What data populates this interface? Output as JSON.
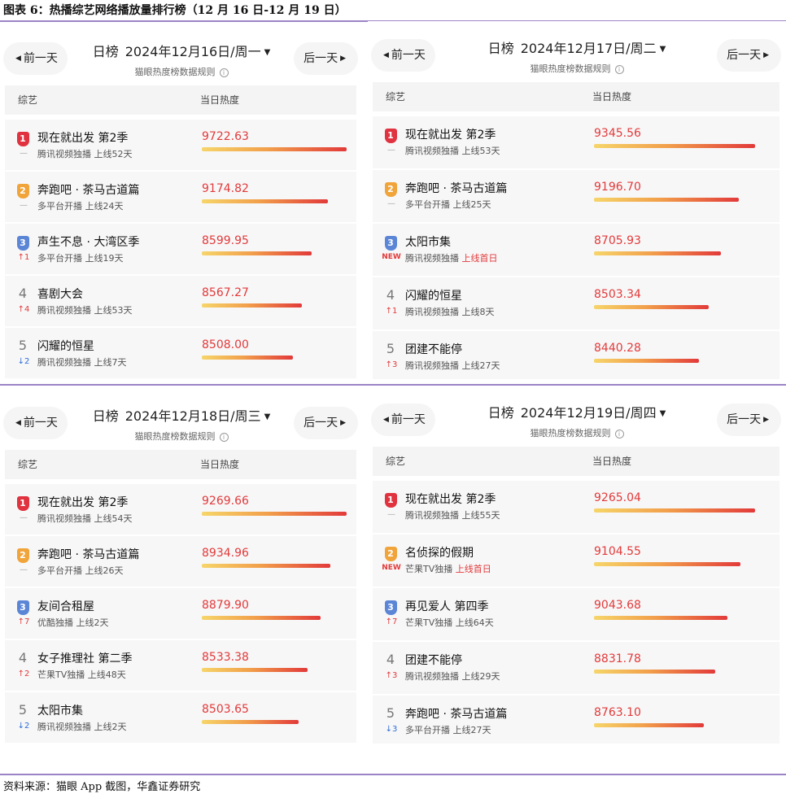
{
  "figure_title": "图表 6：热播综艺网络播放量排行榜（12 月 16 日-12 月 19 日）",
  "source": "资料来源：猫眼 App 截图，华鑫证券研究",
  "colors": {
    "accent_red": "#e23a3a",
    "rank1": "#e0323f",
    "rank2": "#f0a43a",
    "rank3": "#5b86d6",
    "divider": "#9b84c6",
    "bar_gradient": [
      "#f6d56a",
      "#f2a04b",
      "#e23a3a"
    ]
  },
  "icons": {
    "prev": "left-triangle-icon",
    "next": "right-triangle-icon",
    "caret": "caret-down-icon",
    "info": "info-circle-icon",
    "up": "up-arrow-icon",
    "down": "down-arrow-icon"
  },
  "common": {
    "prev_label": "前一天",
    "next_label": "后一天",
    "board_label": "日榜",
    "rule_label": "猫眼热度榜数据规则",
    "col_show": "综艺",
    "col_heat": "当日热度",
    "info_glyph": "i"
  },
  "panels": [
    {
      "date": "2024年12月16日/周一",
      "rows": [
        {
          "rank": "1",
          "change": "—",
          "change_type": "same",
          "title": "现在就出发 第2季",
          "sub": "腾讯视频独播 上线52天",
          "sub_hl": "",
          "heat": "9722.63",
          "bar_pct": 1.0
        },
        {
          "rank": "2",
          "change": "—",
          "change_type": "same",
          "title": "奔跑吧 · 茶马古道篇",
          "sub": "多平台开播 上线24天",
          "sub_hl": "",
          "heat": "9174.82",
          "bar_pct": 0.87
        },
        {
          "rank": "3",
          "change": "↑1",
          "change_type": "up",
          "title": "声生不息 · 大湾区季",
          "sub": "多平台开播 上线19天",
          "sub_hl": "",
          "heat": "8599.95",
          "bar_pct": 0.76
        },
        {
          "rank": "4",
          "change": "↑4",
          "change_type": "up",
          "title": "喜剧大会",
          "sub": "腾讯视频独播 上线53天",
          "sub_hl": "",
          "heat": "8567.27",
          "bar_pct": 0.69
        },
        {
          "rank": "5",
          "change": "↓2",
          "change_type": "down",
          "title": "闪耀的恒星",
          "sub": "腾讯视频独播 上线7天",
          "sub_hl": "",
          "heat": "8508.00",
          "bar_pct": 0.63
        }
      ]
    },
    {
      "date": "2024年12月17日/周二",
      "rows": [
        {
          "rank": "1",
          "change": "—",
          "change_type": "same",
          "title": "现在就出发 第2季",
          "sub": "腾讯视频独播 上线53天",
          "sub_hl": "",
          "heat": "9345.56",
          "bar_pct": 1.0
        },
        {
          "rank": "2",
          "change": "—",
          "change_type": "same",
          "title": "奔跑吧 · 茶马古道篇",
          "sub": "多平台开播 上线25天",
          "sub_hl": "",
          "heat": "9196.70",
          "bar_pct": 0.9
        },
        {
          "rank": "3",
          "change": "NEW",
          "change_type": "new",
          "title": "太阳市集",
          "sub": "腾讯视频独播 ",
          "sub_hl": "上线首日",
          "heat": "8705.93",
          "bar_pct": 0.79
        },
        {
          "rank": "4",
          "change": "↑1",
          "change_type": "up",
          "title": "闪耀的恒星",
          "sub": "腾讯视频独播 上线8天",
          "sub_hl": "",
          "heat": "8503.34",
          "bar_pct": 0.71
        },
        {
          "rank": "5",
          "change": "↑3",
          "change_type": "up",
          "title": "团建不能停",
          "sub": "腾讯视频独播 上线27天",
          "sub_hl": "",
          "heat": "8440.28",
          "bar_pct": 0.65
        }
      ]
    },
    {
      "date": "2024年12月18日/周三",
      "rows": [
        {
          "rank": "1",
          "change": "—",
          "change_type": "same",
          "title": "现在就出发 第2季",
          "sub": "腾讯视频独播 上线54天",
          "sub_hl": "",
          "heat": "9269.66",
          "bar_pct": 1.0
        },
        {
          "rank": "2",
          "change": "—",
          "change_type": "same",
          "title": "奔跑吧 · 茶马古道篇",
          "sub": "多平台开播 上线26天",
          "sub_hl": "",
          "heat": "8934.96",
          "bar_pct": 0.89
        },
        {
          "rank": "3",
          "change": "↑7",
          "change_type": "up",
          "title": "友间合租屋",
          "sub": "优酷独播 上线2天",
          "sub_hl": "",
          "heat": "8879.90",
          "bar_pct": 0.82
        },
        {
          "rank": "4",
          "change": "↑2",
          "change_type": "up",
          "title": "女子推理社 第二季",
          "sub": "芒果TV独播 上线48天",
          "sub_hl": "",
          "heat": "8533.38",
          "bar_pct": 0.73
        },
        {
          "rank": "5",
          "change": "↓2",
          "change_type": "down",
          "title": "太阳市集",
          "sub": "腾讯视频独播 上线2天",
          "sub_hl": "",
          "heat": "8503.65",
          "bar_pct": 0.67
        }
      ]
    },
    {
      "date": "2024年12月19日/周四",
      "rows": [
        {
          "rank": "1",
          "change": "—",
          "change_type": "same",
          "title": "现在就出发 第2季",
          "sub": "腾讯视频独播 上线55天",
          "sub_hl": "",
          "heat": "9265.04",
          "bar_pct": 1.0
        },
        {
          "rank": "2",
          "change": "NEW",
          "change_type": "new",
          "title": "名侦探的假期",
          "sub": "芒果TV独播 ",
          "sub_hl": "上线首日",
          "heat": "9104.55",
          "bar_pct": 0.91
        },
        {
          "rank": "3",
          "change": "↑7",
          "change_type": "up",
          "title": "再见爱人 第四季",
          "sub": "芒果TV独播 上线64天",
          "sub_hl": "",
          "heat": "9043.68",
          "bar_pct": 0.83
        },
        {
          "rank": "4",
          "change": "↑3",
          "change_type": "up",
          "title": "团建不能停",
          "sub": "腾讯视频独播 上线29天",
          "sub_hl": "",
          "heat": "8831.78",
          "bar_pct": 0.75
        },
        {
          "rank": "5",
          "change": "↓3",
          "change_type": "down",
          "title": "奔跑吧 · 茶马古道篇",
          "sub": "多平台开播 上线27天",
          "sub_hl": "",
          "heat": "8763.10",
          "bar_pct": 0.68
        }
      ]
    }
  ]
}
